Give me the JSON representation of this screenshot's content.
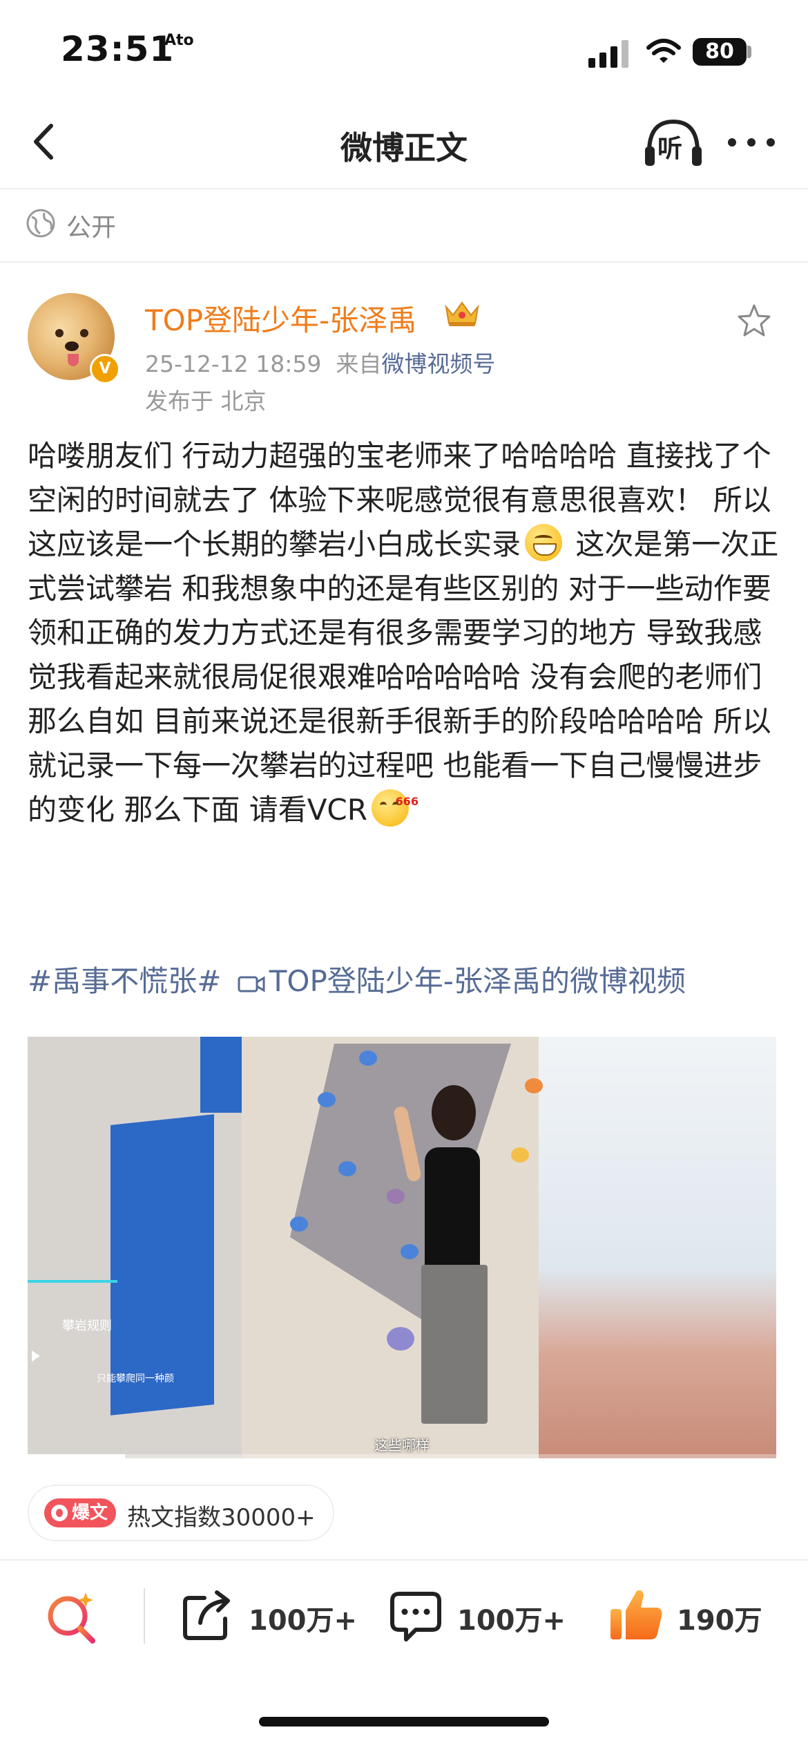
{
  "status_bar": {
    "time": "23:51",
    "sub_icon_text": "Ato",
    "battery": "80"
  },
  "nav": {
    "title": "微博正文",
    "listen_label": "听"
  },
  "visibility": {
    "label": "公开"
  },
  "post": {
    "author": "TOP登陆少年-张泽禹",
    "time": "25-12-12 18:59",
    "source_prefix": "来自",
    "source": "微博视频号",
    "location": "发布于 北京",
    "verified_mark": "V",
    "body_part1": "哈喽朋友们 行动力超强的宝老师来了哈哈哈哈 直接找了个空闲的时间就去了 体验下来呢感觉很有意思很喜欢！ 所以这应该是一个长期的攀岩小白成长实录",
    "body_part2": " 这次是第一次正式尝试攀岩 和我想象中的还是有些区别的 对于一些动作要领和正确的发力方式还是有很多需要学习的地方 导致我感觉我看起来就很局促很艰难哈哈哈哈哈 没有会爬的老师们那么自如 目前来说还是很新手很新手的阶段哈哈哈哈 所以就记录一下每一次攀岩的过程吧 也能看一下自己慢慢进步的变化 那么下面 请看VCR",
    "emoji_666_tag": "666",
    "topic": "#禹事不慌张#",
    "video_link": "TOP登陆少年-张泽禹的微博视频"
  },
  "video": {
    "caption": "这些哪样",
    "overlay_label": "攀岩规则",
    "overlay_sub": "只能攀爬同一种颜",
    "progress": 0.13
  },
  "hot": {
    "tag": "爆文",
    "text": "热文指数30000+"
  },
  "actions": {
    "share_count": "100万+",
    "comment_count": "100万+",
    "like_count": "190万"
  },
  "colors": {
    "author": "#f07c1a",
    "link": "#566b95",
    "meta": "#999999",
    "hot_tag": "#f2545b",
    "like": "#f5843a"
  }
}
